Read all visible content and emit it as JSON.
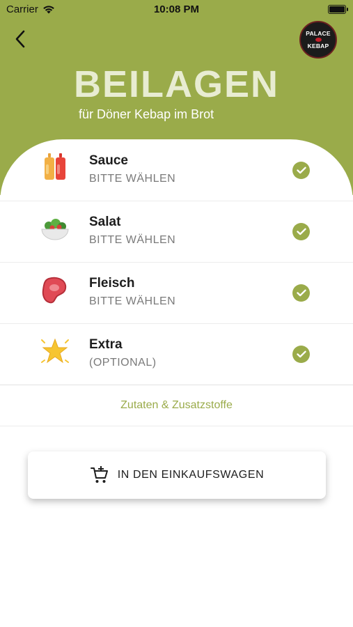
{
  "status_bar": {
    "carrier": "Carrier",
    "time": "10:08 PM"
  },
  "header": {
    "logo": {
      "line1": "PALACE",
      "line2": "KEBAP"
    },
    "title": "BEILAGEN",
    "subtitle": "für Döner Kebap im Brot",
    "background_color": "#9aab4a"
  },
  "options": [
    {
      "name": "Sauce",
      "hint": "BITTE WÄHLEN",
      "icon": "sauce-bottles-icon",
      "selected": true
    },
    {
      "name": "Salat",
      "hint": "BITTE WÄHLEN",
      "icon": "salad-bowl-icon",
      "selected": true
    },
    {
      "name": "Fleisch",
      "hint": "BITTE WÄHLEN",
      "icon": "meat-icon",
      "selected": true
    },
    {
      "name": "Extra",
      "hint": "(OPTIONAL)",
      "icon": "star-icon",
      "selected": true
    }
  ],
  "ingredients_link": "Zutaten & Zusatzstoffe",
  "cart_button": {
    "label": "IN DEN EINKAUFSWAGEN",
    "icon": "add-to-cart-icon"
  },
  "accent_color": "#9aab4a"
}
